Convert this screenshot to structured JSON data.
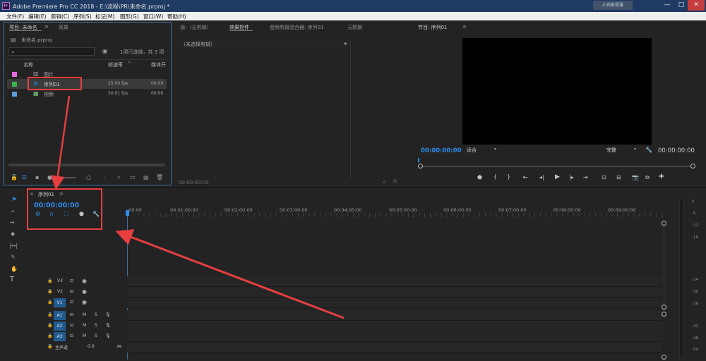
{
  "titlebar": {
    "title": "Adobe Premiere Pro CC 2018 - E:\\流程\\PR\\未命名.prproj *",
    "logo": "Pr",
    "blurred": "小白影视课"
  },
  "window_controls": {
    "minimize": "—",
    "maximize": "□",
    "close": "✕"
  },
  "menu": [
    "文件(F)",
    "编辑(E)",
    "剪辑(C)",
    "序列(S)",
    "标记(M)",
    "图形(G)",
    "窗口(W)",
    "帮助(H)"
  ],
  "project": {
    "tab_project": "项目: 未命名",
    "tab_effects": "效果",
    "tab_menu": "≡",
    "filename": "未命名.prproj",
    "search_placeholder": "",
    "search_icon": "search-icon",
    "status": "1项已选择，共 3 项",
    "columns": {
      "name": "名称",
      "fps": "帧速率",
      "media": "媒体开"
    },
    "items": [
      {
        "name": "图片",
        "fps": "",
        "media": "",
        "color": "#e26be2"
      },
      {
        "name": "序列01",
        "fps": "25.00 fps",
        "media": "00:00",
        "color": "#39b54a"
      },
      {
        "name": "视频",
        "fps": "30.01 fps",
        "media": "00:00",
        "color": "#5e9fd7"
      }
    ]
  },
  "source": {
    "tab_source": "源:（无剪辑）",
    "tab_effect_controls": "效果控件",
    "tab_audio_mixer": "音频剪辑混合器: 序列01",
    "tab_metadata": "元数据",
    "header": "（未选择剪辑）",
    "timecode": "00:00:00:00"
  },
  "program": {
    "tab": "节目: 序列01",
    "tab_menu": "≡",
    "timecode_left": "00:00:00:00",
    "fit": "适合",
    "quality": "完整",
    "timecode_right": "00:00:00:00"
  },
  "timeline": {
    "tab": "序列01",
    "tab_menu": "≡",
    "timecode": "00:00:00:00",
    "ruler": [
      ":00:00",
      "00:01:00:00",
      "00:02:00:00",
      "00:03:00:00",
      "00:04:00:00",
      "00:05:00:00",
      "00:06:00:00",
      "00:07:00:00",
      "00:08:00:00",
      "00:09:00:00"
    ],
    "video_tracks": [
      "V3",
      "V2",
      "V1"
    ],
    "audio_tracks": [
      "A1",
      "A2",
      "A3"
    ],
    "master_label": "主声道",
    "master_value": "0.0",
    "track_m": "M",
    "track_s": "S"
  },
  "meters": {
    "labels": [
      "0",
      "-6",
      "-12",
      "-18",
      "-24",
      "-30",
      "-36",
      "-42",
      "-48",
      "-54"
    ],
    "unit": "dB"
  },
  "colors": {
    "accent": "#2d8ceb",
    "annotation": "#e53f3f",
    "title_bar": "#1f3b63"
  }
}
